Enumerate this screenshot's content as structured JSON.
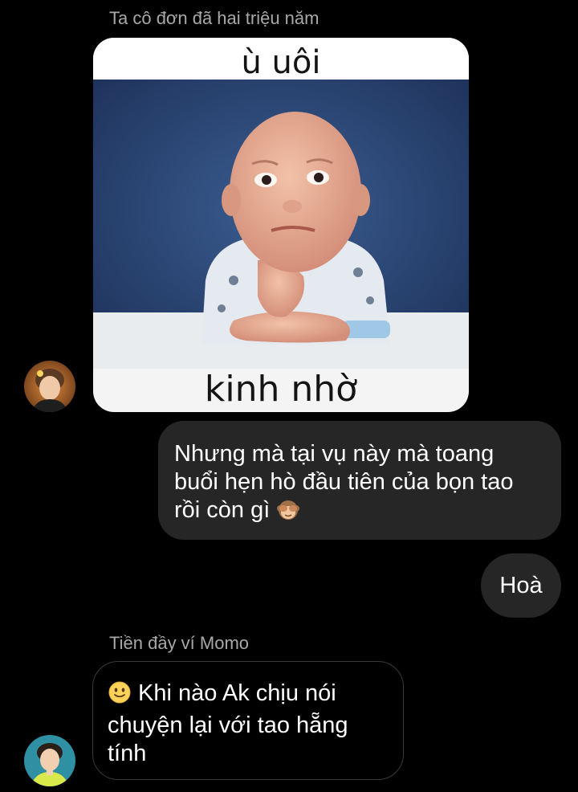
{
  "conversation": {
    "messages": [
      {
        "sender_name": "Ta cô đơn đã hai triệu năm",
        "type": "sticker",
        "sticker": {
          "top_text": "ù uôi",
          "bottom_text": "kinh nhờ"
        }
      },
      {
        "direction": "outgoing",
        "lines": [
          "Nhưng mà tại vụ này mà toang",
          "buổi hẹn hò đầu tiên của bọn tao",
          "rồi còn gì"
        ],
        "trailing_emoji": "see-no-evil-monkey-icon"
      },
      {
        "direction": "outgoing",
        "text": "Hoà"
      },
      {
        "sender_name": "Tiền đầy ví Momo",
        "direction": "incoming",
        "leading_emoji": "slightly-smiling-face-icon",
        "lines": [
          " Khi nào Ak chịu nói",
          "chuyện lại với tao hẵng",
          "tính"
        ]
      }
    ]
  },
  "colors": {
    "background": "#000000",
    "outgoing_bubble": "#262626",
    "incoming_border": "#3a3a3a",
    "sender_name": "#a8a8a8"
  }
}
